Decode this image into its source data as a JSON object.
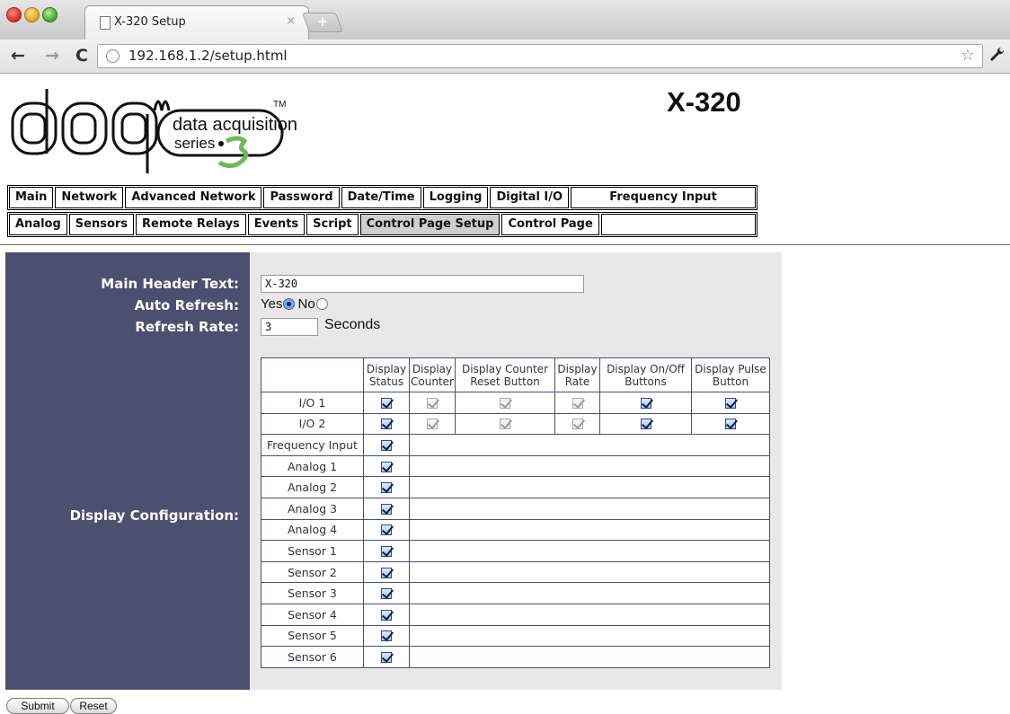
{
  "browser": {
    "tab_title": "X-320 Setup",
    "tab_close": "×",
    "new_tab": "+",
    "url": "192.168.1.2/setup.html",
    "back": "←",
    "forward": "→",
    "reload": "C",
    "star": "☆",
    "wrench": "🔧"
  },
  "logo": {
    "brand": "daq",
    "line1": "data acquisition",
    "line2": "series",
    "number": "3",
    "tm": "TM"
  },
  "device_title": "X-320",
  "nav": {
    "row1": [
      "Main",
      "Network",
      "Advanced Network",
      "Password",
      "Date/Time",
      "Logging",
      "Digital I/O",
      "Frequency Input"
    ],
    "row2": [
      "Analog",
      "Sensors",
      "Remote Relays",
      "Events",
      "Script",
      "Control Page Setup",
      "Control Page"
    ],
    "active": "Control Page Setup"
  },
  "form": {
    "main_header_label": "Main Header Text:",
    "main_header_value": "X-320",
    "auto_refresh_label": "Auto Refresh:",
    "yes_label": "Yes",
    "no_label": "No",
    "auto_refresh_value": "Yes",
    "refresh_rate_label": "Refresh Rate:",
    "refresh_rate_value": "3",
    "seconds_label": "Seconds",
    "display_config_label": "Display Configuration:"
  },
  "table": {
    "headers": [
      "",
      "Display Status",
      "Display Counter",
      "Display Counter Reset Button",
      "Display Rate",
      "Display On/Off Buttons",
      "Display Pulse Button"
    ],
    "io_rows": [
      {
        "label": "I/O 1",
        "status": true,
        "counter": true,
        "counter_reset": true,
        "rate": true,
        "onoff": true,
        "pulse": true
      },
      {
        "label": "I/O 2",
        "status": true,
        "counter": true,
        "counter_reset": true,
        "rate": true,
        "onoff": true,
        "pulse": true
      }
    ],
    "other_rows": [
      {
        "label": "Frequency Input",
        "status": true
      },
      {
        "label": "Analog 1",
        "status": true
      },
      {
        "label": "Analog 2",
        "status": true
      },
      {
        "label": "Analog 3",
        "status": true
      },
      {
        "label": "Analog 4",
        "status": true
      },
      {
        "label": "Sensor 1",
        "status": true
      },
      {
        "label": "Sensor 2",
        "status": true
      },
      {
        "label": "Sensor 3",
        "status": true
      },
      {
        "label": "Sensor 4",
        "status": true
      },
      {
        "label": "Sensor 5",
        "status": true
      },
      {
        "label": "Sensor 6",
        "status": true
      }
    ]
  },
  "buttons": {
    "submit": "Submit",
    "reset": "Reset"
  },
  "colors": {
    "panel_left": "#4b5070",
    "panel_right": "#e8e8e8",
    "active_tab": "#cfcfcf",
    "logo_green": "#6dbb57"
  }
}
